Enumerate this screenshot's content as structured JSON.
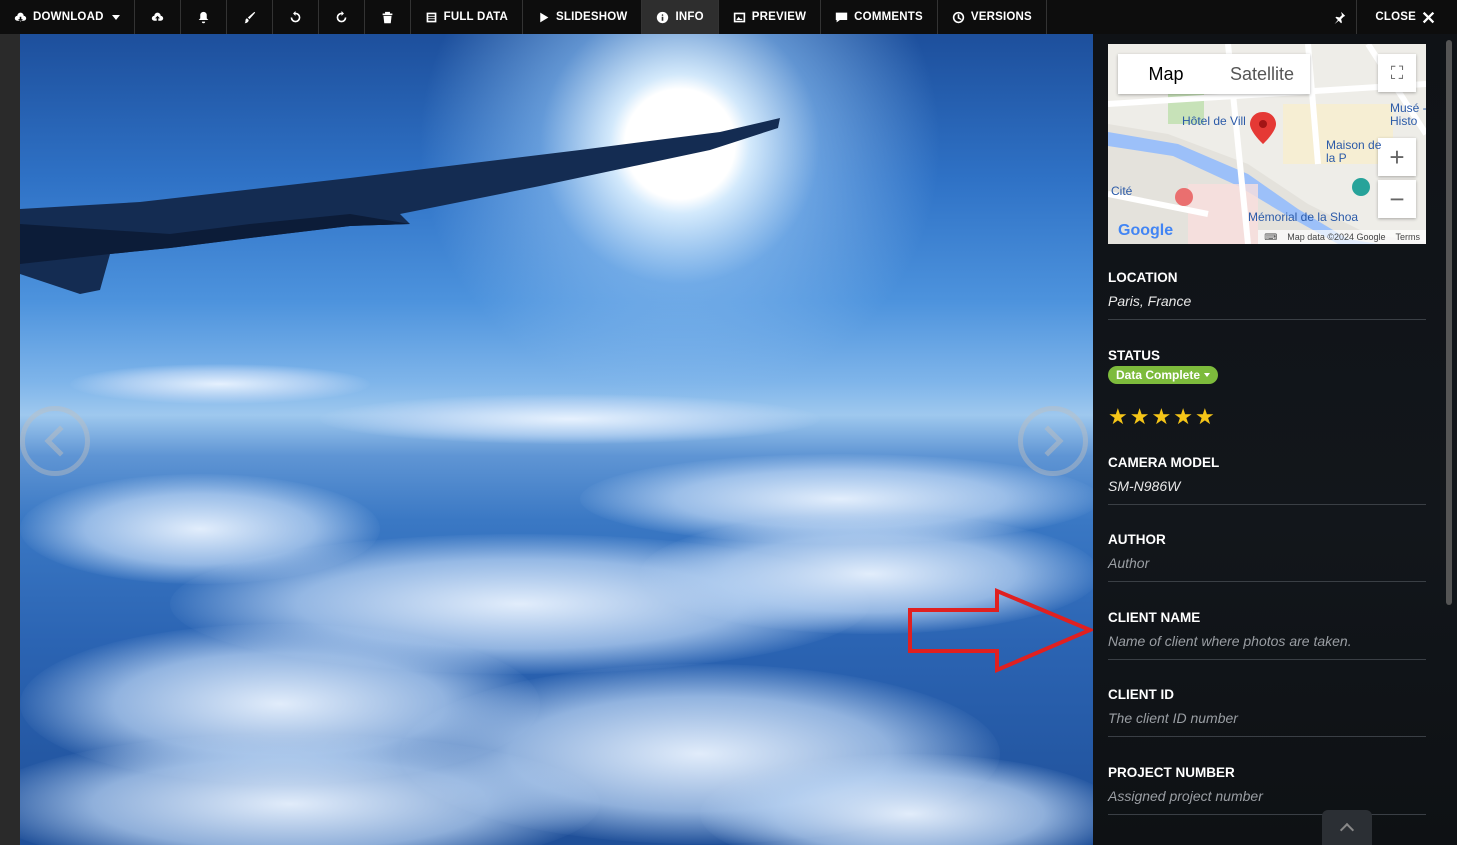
{
  "toolbar": {
    "download_label": "DOWNLOAD",
    "full_data_label": "FULL DATA",
    "slideshow_label": "SLIDESHOW",
    "info_label": "INFO",
    "preview_label": "PREVIEW",
    "comments_label": "COMMENTS",
    "versions_label": "VERSIONS",
    "close_label": "CLOSE"
  },
  "map": {
    "map_tab": "Map",
    "satellite_tab": "Satellite",
    "labels": [
      "Hôtel de Vill",
      "Maison de la P",
      "Cité",
      "Mémorial de la Shoa",
      "Musé - Histo"
    ],
    "google": "Google",
    "attribution": "Map data ©2024 Google",
    "terms": "Terms"
  },
  "info": {
    "location": {
      "label": "LOCATION",
      "value": "Paris, France"
    },
    "status": {
      "label": "STATUS",
      "value": "Data Complete",
      "color": "#7dbb3c"
    },
    "rating": 5,
    "camera_model": {
      "label": "CAMERA MODEL",
      "value": "SM-N986W"
    },
    "author": {
      "label": "AUTHOR",
      "placeholder": "Author"
    },
    "client_name": {
      "label": "CLIENT NAME",
      "placeholder": "Name of client where photos are taken."
    },
    "client_id": {
      "label": "CLIENT ID",
      "placeholder": "The client ID number"
    },
    "project_number": {
      "label": "PROJECT NUMBER",
      "placeholder": "Assigned project number"
    }
  },
  "annotation_color": "#e02020"
}
